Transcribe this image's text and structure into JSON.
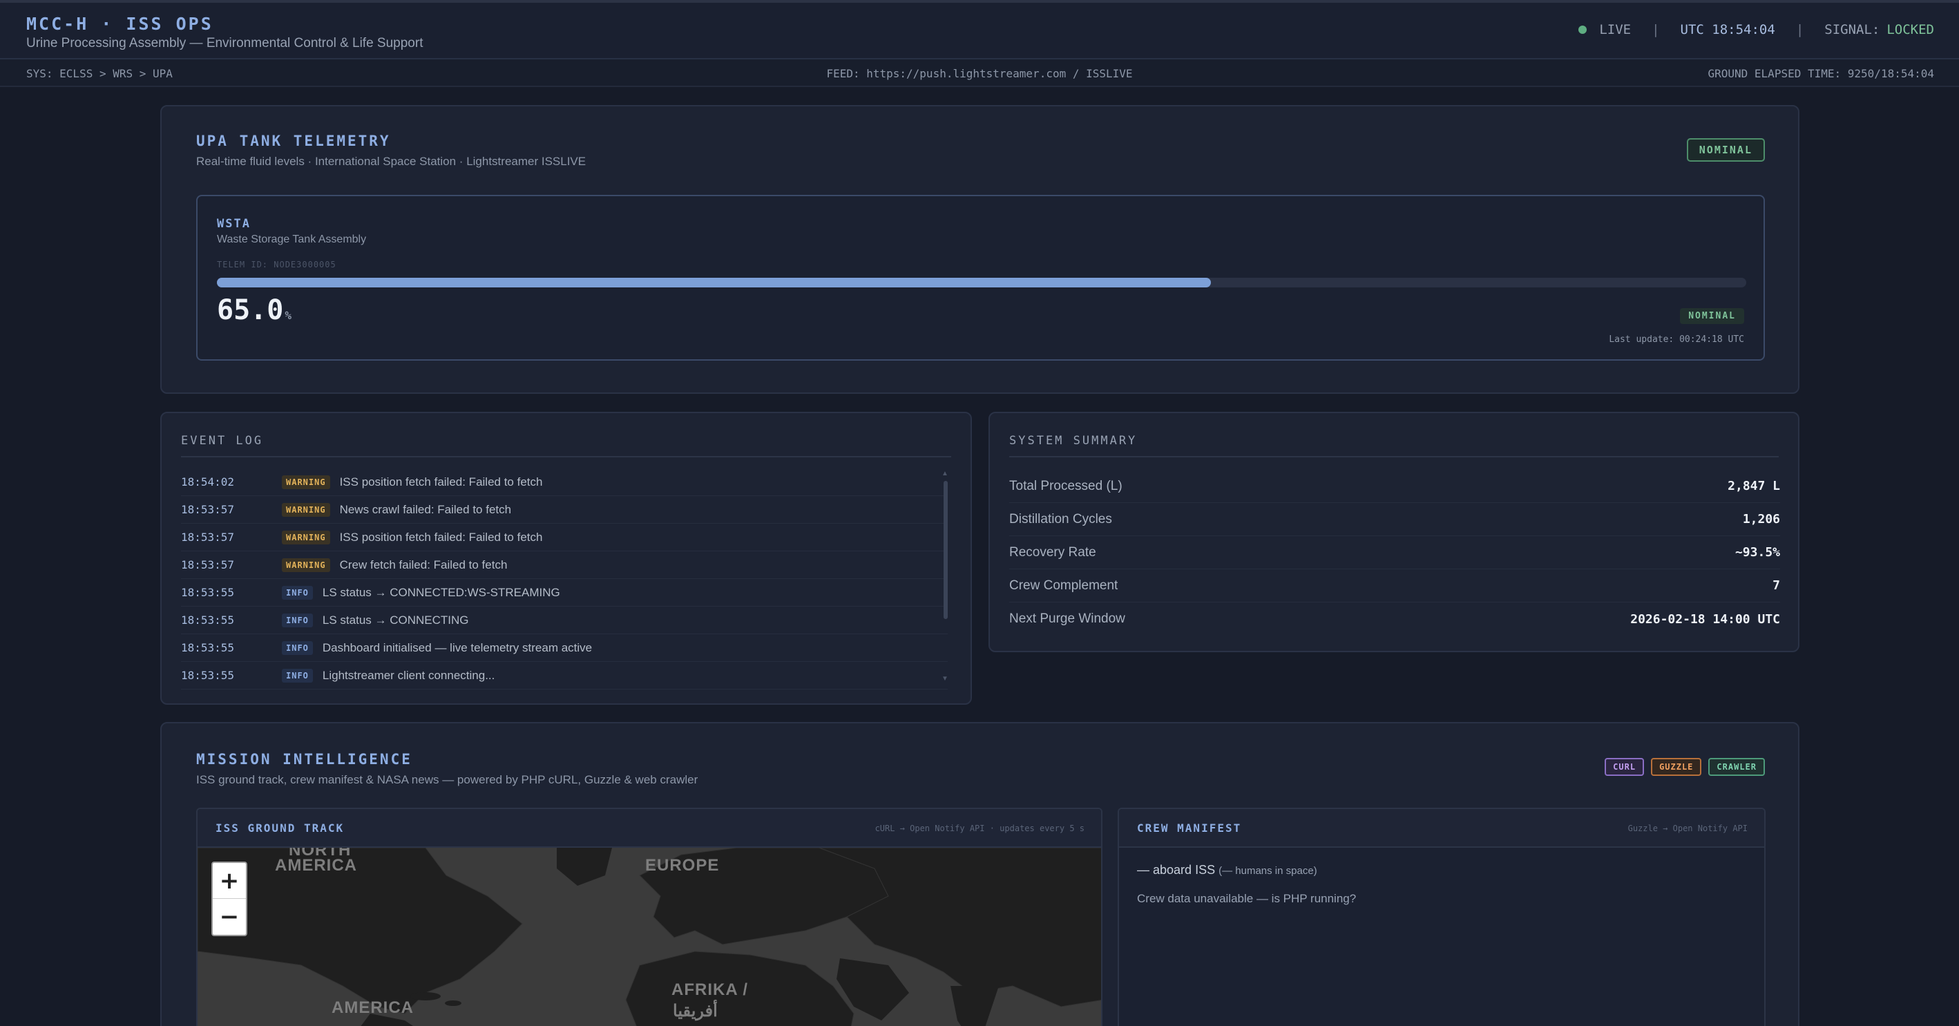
{
  "header": {
    "title": "MCC-H · ISS OPS",
    "subtitle": "Urine Processing Assembly — Environmental Control & Life Support",
    "live_label": "LIVE",
    "utc": "UTC 18:54:04",
    "signal_label": "SIGNAL:",
    "signal_value": "LOCKED",
    "separator": "|"
  },
  "subbar": {
    "breadcrumb": "SYS: ECLSS > WRS > UPA",
    "feed": "FEED: https://push.lightstreamer.com / ISSLIVE",
    "elapsed": "GROUND ELAPSED TIME: 9250/18:54:04"
  },
  "upa": {
    "title": "UPA TANK TELEMETRY",
    "subtitle": "Real-time fluid levels · International Space Station · Lightstreamer ISSLIVE",
    "status": "NOMINAL",
    "tank": {
      "name": "WSTA",
      "description": "Waste Storage Tank Assembly",
      "telem_id": "TELEM ID: NODE3000005",
      "level_percent": 65.0,
      "value": "65.0",
      "unit": "%",
      "status": "NOMINAL",
      "last_update": "Last update: 00:24:18 UTC"
    }
  },
  "event_log": {
    "title": "EVENT LOG",
    "entries": [
      {
        "time": "18:54:02",
        "level": "WARNING",
        "message": "ISS position fetch failed: Failed to fetch"
      },
      {
        "time": "18:53:57",
        "level": "WARNING",
        "message": "News crawl failed: Failed to fetch"
      },
      {
        "time": "18:53:57",
        "level": "WARNING",
        "message": "ISS position fetch failed: Failed to fetch"
      },
      {
        "time": "18:53:57",
        "level": "WARNING",
        "message": "Crew fetch failed: Failed to fetch"
      },
      {
        "time": "18:53:55",
        "level": "INFO",
        "message": "LS status → CONNECTED:WS-STREAMING"
      },
      {
        "time": "18:53:55",
        "level": "INFO",
        "message": "LS status → CONNECTING"
      },
      {
        "time": "18:53:55",
        "level": "INFO",
        "message": "Dashboard initialised — live telemetry stream active"
      },
      {
        "time": "18:53:55",
        "level": "INFO",
        "message": "Lightstreamer client connecting..."
      }
    ]
  },
  "summary": {
    "title": "SYSTEM SUMMARY",
    "rows": [
      {
        "label": "Total Processed (L)",
        "value": "2,847 L"
      },
      {
        "label": "Distillation Cycles",
        "value": "1,206"
      },
      {
        "label": "Recovery Rate",
        "value": "~93.5%"
      },
      {
        "label": "Crew Complement",
        "value": "7"
      },
      {
        "label": "Next Purge Window",
        "value": "2026-02-18 14:00 UTC"
      }
    ]
  },
  "mission": {
    "title": "MISSION INTELLIGENCE",
    "subtitle": "ISS ground track, crew manifest & NASA news — powered by PHP cURL, Guzzle & web crawler",
    "tags": [
      "CURL",
      "GUZZLE",
      "CRAWLER"
    ],
    "ground_track": {
      "title": "ISS GROUND TRACK",
      "meta": "cURL → Open Notify API · updates every 5 s",
      "zoom_in": "+",
      "zoom_out": "−",
      "map_labels": {
        "north": "NORTH",
        "america": "AMERICA",
        "europe": "EUROPE",
        "america_south": "AMERICA",
        "afrika": "AFRIKA /",
        "afrika_ar": "أفريقيا"
      }
    },
    "crew": {
      "title": "CREW MANIFEST",
      "meta": "Guzzle → Open Notify API",
      "count": "—",
      "aboard_label": "aboard ISS",
      "humans_prefix": "(",
      "humans_count": "—",
      "humans_suffix": " humans in space)",
      "message": "Crew data unavailable — is PHP running?"
    }
  },
  "colors": {
    "accent": "#8eaee3",
    "nominal": "#7fc39a",
    "warning": "#e2b25a",
    "bar_fill": "#7da0d8",
    "background": "#161b28"
  }
}
